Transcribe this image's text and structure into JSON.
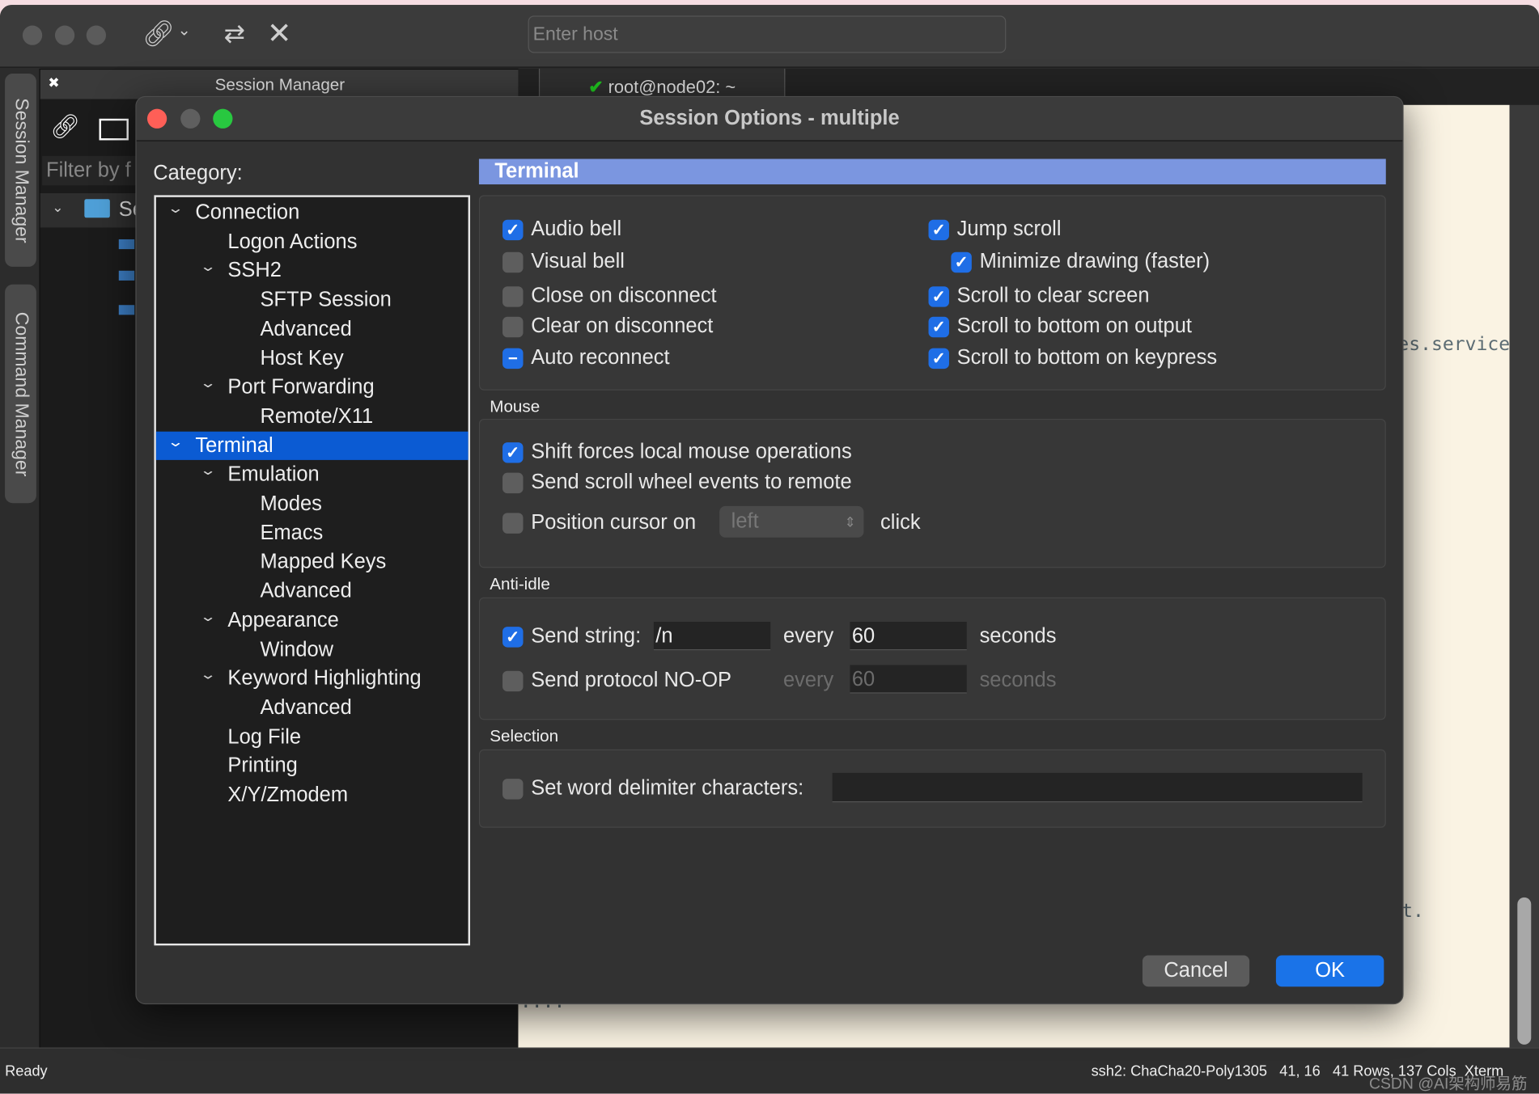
{
  "app": {
    "host_placeholder": "Enter host",
    "session_manager_title": "Session Manager",
    "filter_placeholder": "Filter by f",
    "tree_root_label": "Se",
    "side_tabs": [
      "Session Manager",
      "Command Manager"
    ],
    "terminal_tab": "root@node02: ~",
    "terminal_lines": [
      "es.service",
      "t.",
      "...."
    ]
  },
  "status": {
    "left": "Ready",
    "right": "ssh2: ChaCha20-Poly1305   41, 16   41 Rows, 137 Cols  Xterm",
    "watermark": "CSDN @AI架构师易筋"
  },
  "dialog": {
    "title": "Session Options - multiple",
    "category_label": "Category:",
    "tree": [
      {
        "label": "Connection",
        "level": 0,
        "expanded": true
      },
      {
        "label": "Logon Actions",
        "level": 1
      },
      {
        "label": "SSH2",
        "level": 1,
        "expanded": true
      },
      {
        "label": "SFTP Session",
        "level": 2
      },
      {
        "label": "Advanced",
        "level": 2
      },
      {
        "label": "Host Key",
        "level": 2
      },
      {
        "label": "Port Forwarding",
        "level": 1,
        "expanded": true
      },
      {
        "label": "Remote/X11",
        "level": 2
      },
      {
        "label": "Terminal",
        "level": 0,
        "expanded": true,
        "selected": true
      },
      {
        "label": "Emulation",
        "level": 1,
        "expanded": true
      },
      {
        "label": "Modes",
        "level": 2
      },
      {
        "label": "Emacs",
        "level": 2
      },
      {
        "label": "Mapped Keys",
        "level": 2
      },
      {
        "label": "Advanced",
        "level": 2
      },
      {
        "label": "Appearance",
        "level": 1,
        "expanded": true
      },
      {
        "label": "Window",
        "level": 2
      },
      {
        "label": "Keyword Highlighting",
        "level": 1,
        "expanded": true
      },
      {
        "label": "Advanced",
        "level": 2
      },
      {
        "label": "Log File",
        "level": 1
      },
      {
        "label": "Printing",
        "level": 1
      },
      {
        "label": "X/Y/Zmodem",
        "level": 1
      }
    ],
    "section_title": "Terminal",
    "terminal_options": {
      "left": [
        {
          "label": "Audio bell",
          "state": "checked"
        },
        {
          "label": "Visual bell",
          "state": "unchecked"
        },
        {
          "label": "Close on disconnect",
          "state": "unchecked"
        },
        {
          "label": "Clear on disconnect",
          "state": "unchecked"
        },
        {
          "label": "Auto reconnect",
          "state": "mixed"
        }
      ],
      "right": [
        {
          "label": "Jump scroll",
          "state": "checked"
        },
        {
          "label": "Minimize drawing (faster)",
          "state": "checked"
        },
        {
          "label": "Scroll to clear screen",
          "state": "checked"
        },
        {
          "label": "Scroll to bottom on output",
          "state": "checked"
        },
        {
          "label": "Scroll to bottom on keypress",
          "state": "checked"
        }
      ]
    },
    "mouse": {
      "title": "Mouse",
      "shift_forces": {
        "label": "Shift forces local mouse operations",
        "state": "checked"
      },
      "scroll_wheel": {
        "label": "Send scroll wheel events to remote",
        "state": "unchecked"
      },
      "position_cursor": {
        "label": "Position cursor on",
        "state": "unchecked",
        "select_value": "left",
        "suffix": "click"
      }
    },
    "anti_idle": {
      "title": "Anti-idle",
      "send_string": {
        "label": "Send string:",
        "state": "checked",
        "value": "/n",
        "every": "every",
        "interval": "60",
        "unit": "seconds"
      },
      "noop": {
        "label": "Send protocol NO-OP",
        "state": "unchecked",
        "every": "every",
        "interval": "60",
        "unit": "seconds"
      }
    },
    "selection": {
      "title": "Selection",
      "word_delim": {
        "label": "Set word delimiter characters:",
        "state": "unchecked",
        "value": ""
      }
    },
    "buttons": {
      "cancel": "Cancel",
      "ok": "OK"
    }
  },
  "colors": {
    "accent": "#0b5bd3",
    "header": "#7b96e0",
    "checkbox": "#1f6ee6",
    "terminal_bg": "#faf3e3"
  }
}
